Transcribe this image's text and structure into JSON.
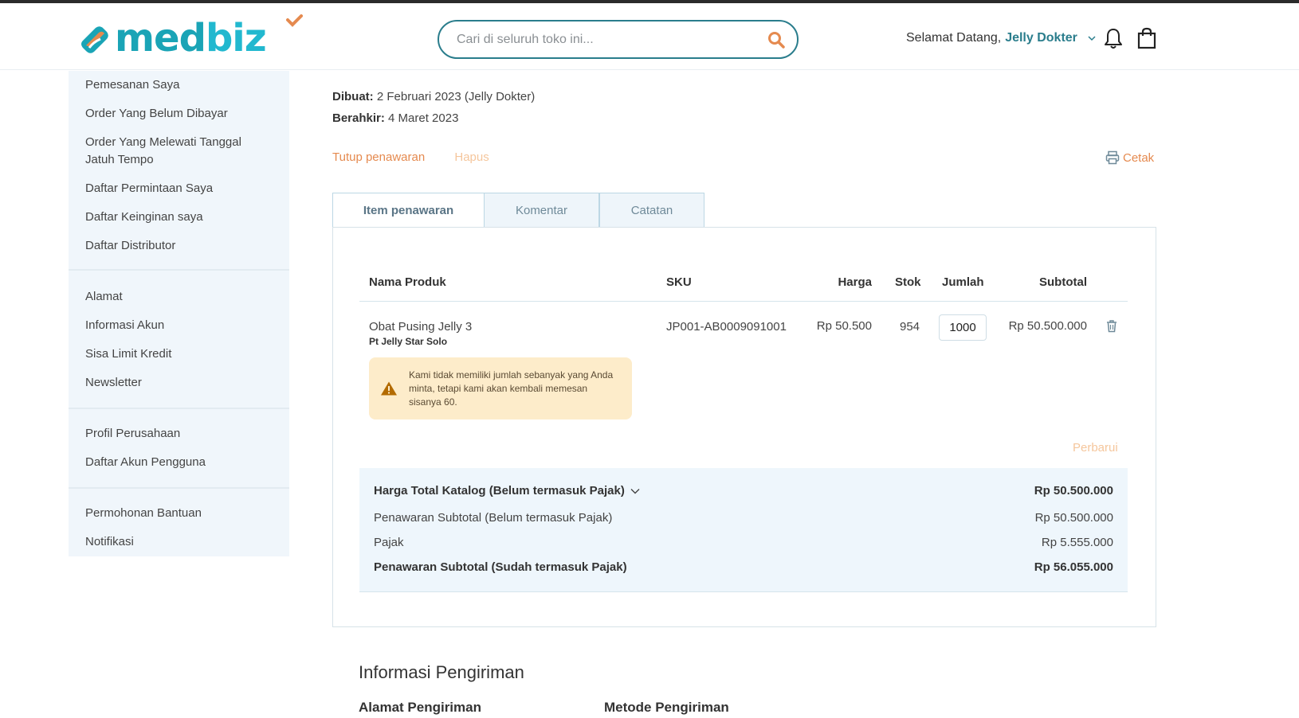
{
  "header": {
    "logo": {
      "text_a": "med",
      "text_b": "biz"
    },
    "search": {
      "placeholder": "Cari di seluruh toko ini..."
    },
    "welcome_prefix": "Selamat Datang,",
    "user_name": "Jelly Dokter",
    "icons": [
      "search-icon",
      "chevron-down-icon",
      "bell-icon",
      "shopping-bag-icon"
    ]
  },
  "sidebar": {
    "groups": [
      [
        "Pemesanan Saya",
        "Order Yang Belum Dibayar",
        "Order Yang Melewati Tanggal Jatuh Tempo",
        "Daftar Permintaan Saya",
        "Daftar Keinginan saya",
        "Daftar Distributor"
      ],
      [
        "Alamat",
        "Informasi Akun",
        "Sisa Limit Kredit",
        "Newsletter"
      ],
      [
        "Profil Perusahaan",
        "Daftar Akun Pengguna"
      ],
      [
        "Permohonan Bantuan",
        "Notifikasi"
      ]
    ]
  },
  "quote": {
    "created_label": "Dibuat:",
    "created_value": "2 Februari 2023 (Jelly Dokter)",
    "expires_label": "Berahkir:",
    "expires_value": "4 Maret 2023",
    "close_offer": "Tutup penawaran",
    "delete": "Hapus",
    "print": "Cetak"
  },
  "tabs": [
    "Item penawaran",
    "Komentar",
    "Catatan"
  ],
  "table": {
    "headers": {
      "name": "Nama Produk",
      "sku": "SKU",
      "price": "Harga",
      "stock": "Stok",
      "qty": "Jumlah",
      "subtotal": "Subtotal"
    },
    "rows": [
      {
        "name": "Obat Pusing Jelly 3",
        "seller": "Pt Jelly Star Solo",
        "sku": "JP001-AB0009091001",
        "price": "Rp 50.500",
        "stock": "954",
        "qty": "1000",
        "subtotal": "Rp 50.500.000",
        "warning": "Kami tidak memiliki jumlah sebanyak yang Anda minta, tetapi kami akan kembali memesan sisanya 60."
      }
    ],
    "refresh": "Perbarui"
  },
  "totals": {
    "catalog_label": "Harga Total Katalog (Belum termasuk Pajak)",
    "catalog_value": "Rp 50.500.000",
    "subtotal_excl_label": "Penawaran Subtotal (Belum termasuk Pajak)",
    "subtotal_excl_value": "Rp 50.500.000",
    "tax_label": "Pajak",
    "tax_value": "Rp 5.555.000",
    "subtotal_incl_label": "Penawaran Subtotal (Sudah termasuk Pajak)",
    "subtotal_incl_value": "Rp 56.055.000"
  },
  "shipping": {
    "title": "Informasi Pengiriman",
    "address_title": "Alamat Pengiriman",
    "method_title": "Metode Pengiriman"
  },
  "colors": {
    "brand_teal": "#2a7d8c",
    "accent_orange": "#e58a4f",
    "sidebar_bg": "#f0f6fb",
    "warning_bg": "#fdecca"
  }
}
